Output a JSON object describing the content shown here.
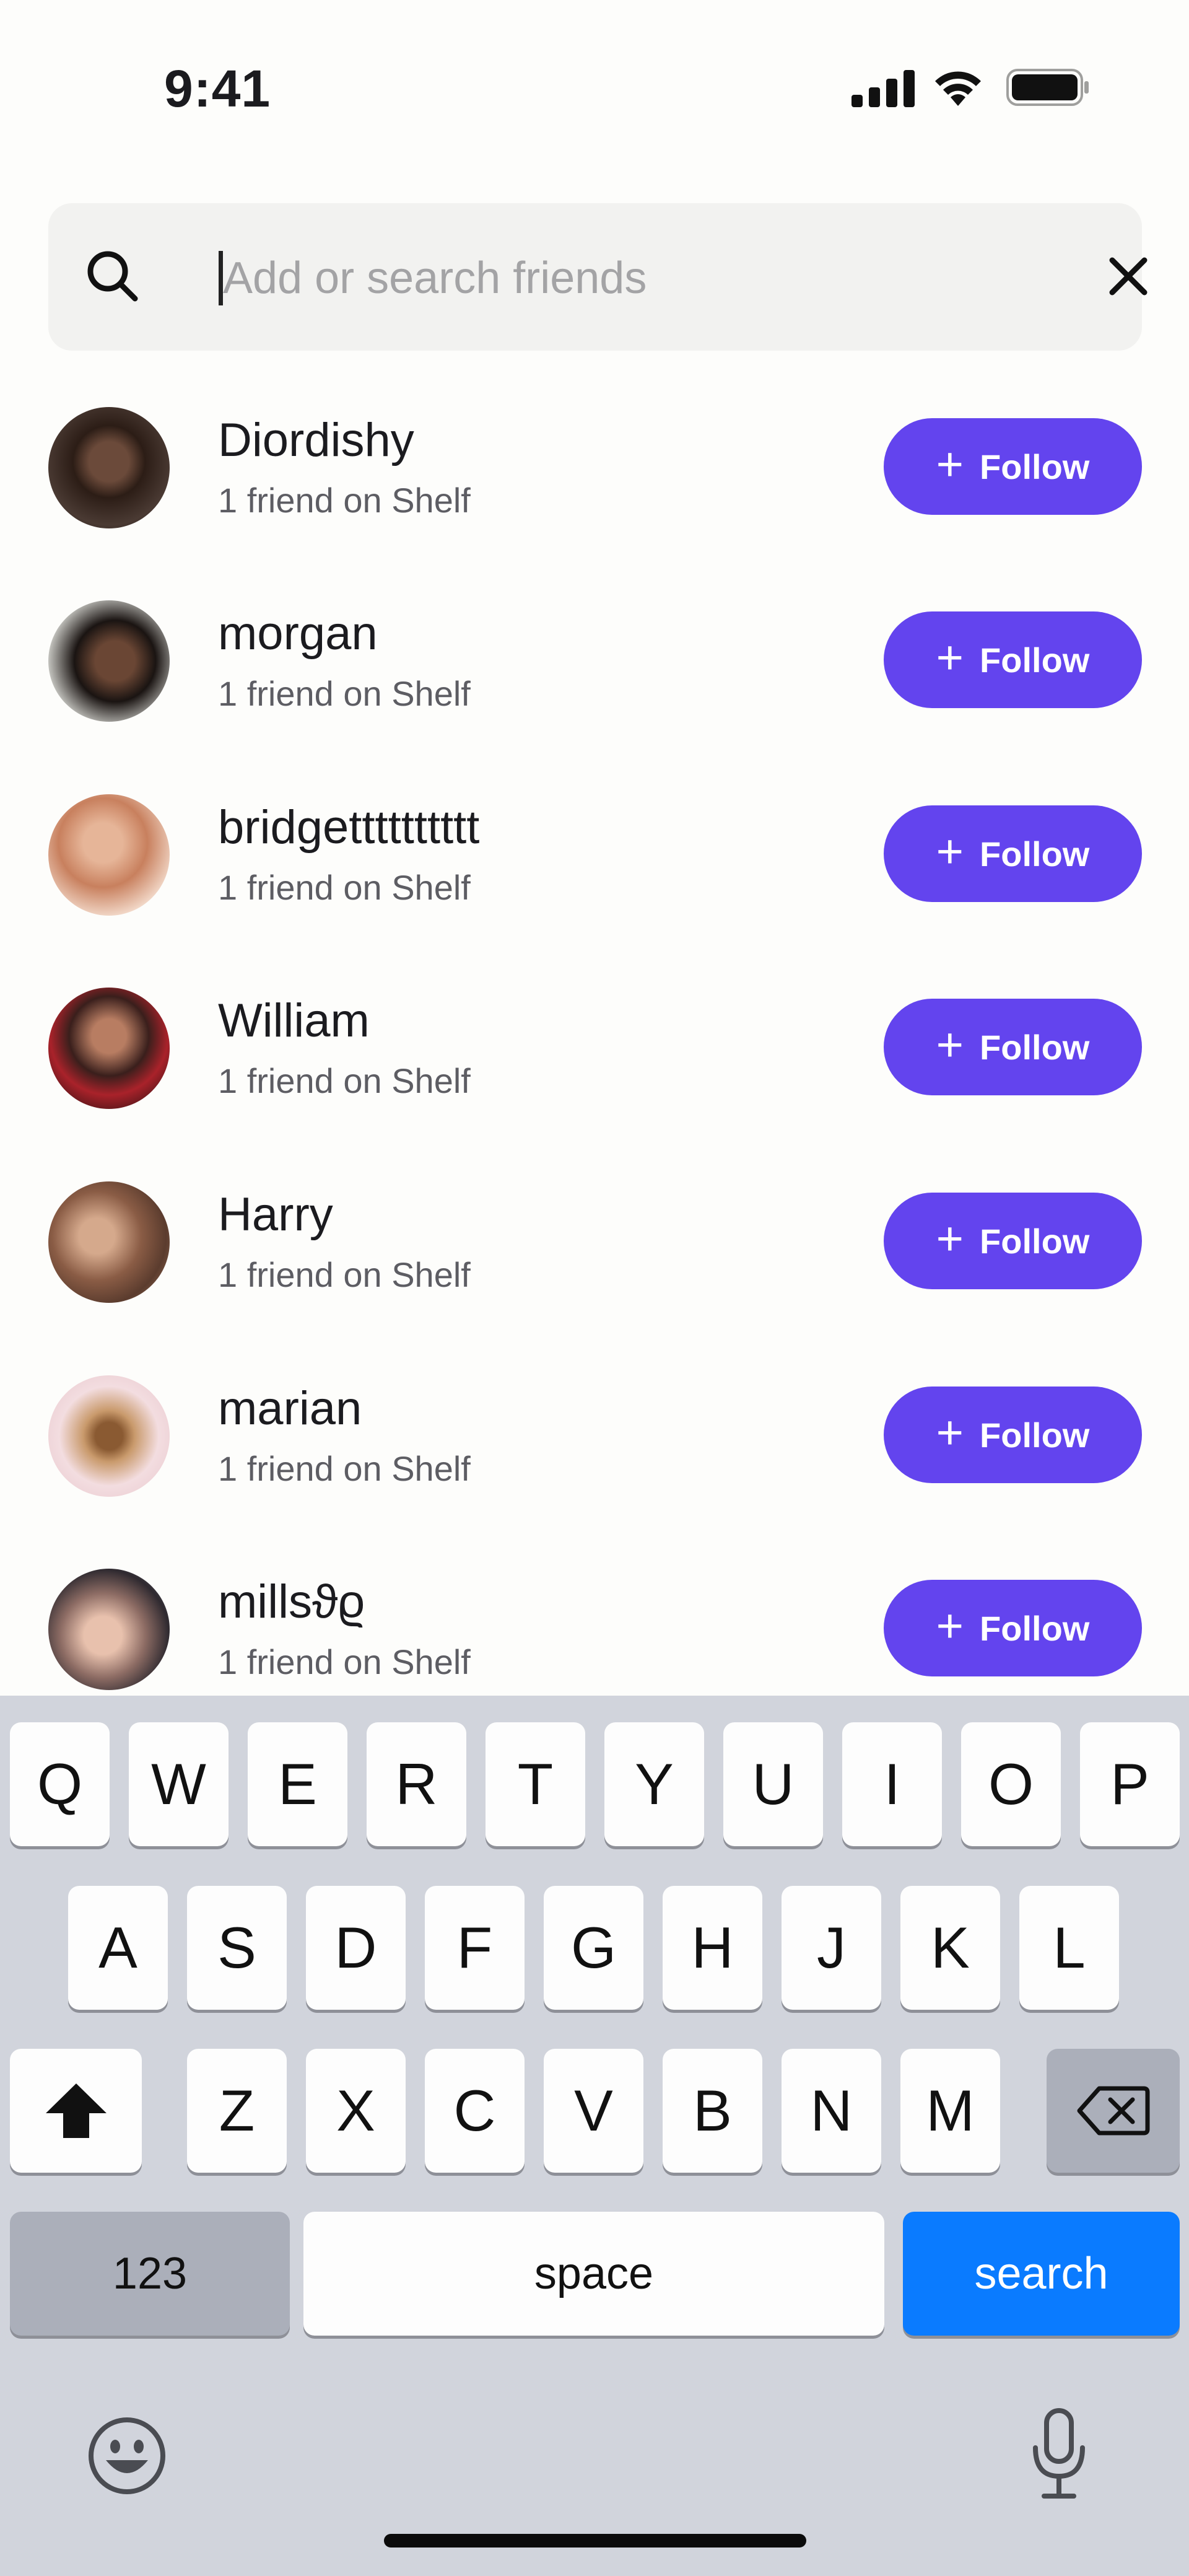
{
  "status_bar": {
    "time": "9:41"
  },
  "search": {
    "placeholder": "Add or search friends",
    "value": ""
  },
  "friends": [
    {
      "name": "Diordishy",
      "subtitle": "1 friend on Shelf",
      "button": "Follow"
    },
    {
      "name": "morgan",
      "subtitle": "1 friend on Shelf",
      "button": "Follow"
    },
    {
      "name": "bridgetttttttttt",
      "subtitle": "1 friend on Shelf",
      "button": "Follow"
    },
    {
      "name": "William",
      "subtitle": "1 friend on Shelf",
      "button": "Follow"
    },
    {
      "name": "Harry",
      "subtitle": "1 friend on Shelf",
      "button": "Follow"
    },
    {
      "name": "marian",
      "subtitle": "1 friend on Shelf",
      "button": "Follow"
    },
    {
      "name": "millsϑϱ",
      "subtitle": "1 friend on Shelf",
      "button": "Follow"
    }
  ],
  "keyboard": {
    "row1": [
      "Q",
      "W",
      "E",
      "R",
      "T",
      "Y",
      "U",
      "I",
      "O",
      "P"
    ],
    "row2": [
      "A",
      "S",
      "D",
      "F",
      "G",
      "H",
      "J",
      "K",
      "L"
    ],
    "row3": [
      "Z",
      "X",
      "C",
      "V",
      "B",
      "N",
      "M"
    ],
    "numbers_label": "123",
    "space_label": "space",
    "return_label": "search"
  },
  "colors": {
    "accent": "#6344ee",
    "search_key": "#0a7bff",
    "keyboard_bg": "#d1d4dc"
  },
  "icons": [
    "search-icon",
    "close-icon",
    "cellular-icon",
    "wifi-icon",
    "battery-icon",
    "shift-icon",
    "backspace-icon",
    "emoji-icon",
    "microphone-icon"
  ]
}
